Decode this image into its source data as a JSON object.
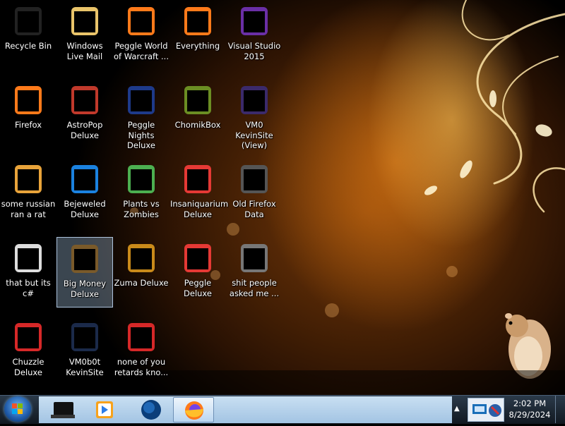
{
  "desktop": {
    "icons": [
      {
        "label": "Recycle Bin",
        "icon": "recycle-bin-icon"
      },
      {
        "label": "Windows Live Mail",
        "icon": "windows-live-mail-icon"
      },
      {
        "label": "Peggle World of Warcraft ...",
        "icon": "peggle-world-of-warcraft-icon"
      },
      {
        "label": "Everything",
        "icon": "everything-search-icon"
      },
      {
        "label": "Visual Studio 2015",
        "icon": "visual-studio-icon"
      },
      {
        "label": "Firefox",
        "icon": "firefox-icon"
      },
      {
        "label": "AstroPop Deluxe",
        "icon": "astropop-icon"
      },
      {
        "label": "Peggle Nights Deluxe",
        "icon": "peggle-nights-icon"
      },
      {
        "label": "ChomikBox",
        "icon": "chomikbox-icon"
      },
      {
        "label": "VM0 KevinSite (View)",
        "icon": "visual-studio-solution-icon"
      },
      {
        "label": "some russian ran a rat",
        "icon": "exe-file-icon"
      },
      {
        "label": "Bejeweled Deluxe",
        "icon": "bejeweled-icon"
      },
      {
        "label": "Plants vs Zombies",
        "icon": "plants-vs-zombies-icon"
      },
      {
        "label": "Insaniquarium Deluxe",
        "icon": "insaniquarium-icon"
      },
      {
        "label": "Old Firefox Data",
        "icon": "folder-icon"
      },
      {
        "label": "that but its c#",
        "icon": "copy-files-icon"
      },
      {
        "label": "Big Money Deluxe",
        "icon": "big-money-icon"
      },
      {
        "label": "Zuma Deluxe",
        "icon": "zuma-icon"
      },
      {
        "label": "Peggle Deluxe",
        "icon": "peggle-icon"
      },
      {
        "label": "shit people asked me ...",
        "icon": "folder-documents-icon"
      },
      {
        "label": "Chuzzle Deluxe",
        "icon": "chuzzle-icon"
      },
      {
        "label": "VM0b0t KevinSite",
        "icon": "vm-shortcut-icon"
      },
      {
        "label": "none of you retards kno...",
        "icon": "popcap-game-icon"
      }
    ]
  },
  "taskbar": {
    "start": "windows-start-orb-icon",
    "pinned": [
      {
        "icon": "terminal-icon"
      },
      {
        "icon": "media-player-icon"
      },
      {
        "icon": "globe-icon"
      },
      {
        "icon": "firefox-icon"
      }
    ],
    "tray_arrow": "▲",
    "clock": {
      "time": "2:02 PM",
      "date": "8/29/2024"
    }
  },
  "colors": {
    "taskbar_strip": "#b6d2ec",
    "selection": "#aac8e6"
  }
}
